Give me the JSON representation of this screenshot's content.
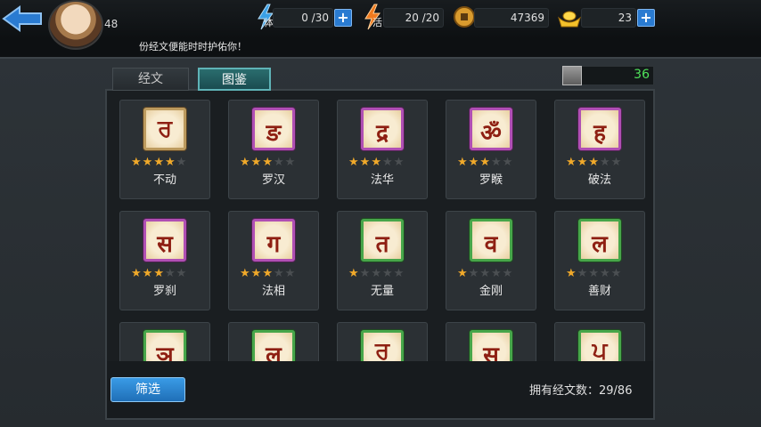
{
  "header": {
    "level": "48",
    "stamina": {
      "label": "体",
      "value": "0 /30"
    },
    "vitality": {
      "label": "活",
      "value": "20 /20"
    },
    "coins": {
      "value": "47369"
    },
    "gold": {
      "value": "23"
    },
    "plus": "+",
    "notice": "份经文便能时时护佑你！"
  },
  "tabs": [
    {
      "label": "经文",
      "active": false
    },
    {
      "label": "图鉴",
      "active": true
    }
  ],
  "collection_count": "36",
  "cards": [
    {
      "name": "不动",
      "stars": 4,
      "glyph": "ਰ",
      "frame": "gold"
    },
    {
      "name": "罗汉",
      "stars": 3,
      "glyph": "ङ",
      "frame": "purple"
    },
    {
      "name": "法华",
      "stars": 3,
      "glyph": "द्र",
      "frame": "purple"
    },
    {
      "name": "罗睺",
      "stars": 3,
      "glyph": "ॐ",
      "frame": "purple"
    },
    {
      "name": "破法",
      "stars": 3,
      "glyph": "ह",
      "frame": "purple"
    },
    {
      "name": "罗刹",
      "stars": 3,
      "glyph": "स",
      "frame": "purple"
    },
    {
      "name": "法相",
      "stars": 3,
      "glyph": "ग",
      "frame": "purple"
    },
    {
      "name": "无量",
      "stars": 1,
      "glyph": "त",
      "frame": "green"
    },
    {
      "name": "金刚",
      "stars": 1,
      "glyph": "व",
      "frame": "green"
    },
    {
      "name": "善财",
      "stars": 1,
      "glyph": "ल",
      "frame": "green"
    },
    {
      "name": "",
      "stars": 0,
      "glyph": "ञ",
      "frame": "green"
    },
    {
      "name": "",
      "stars": 0,
      "glyph": "ल",
      "frame": "green"
    },
    {
      "name": "",
      "stars": 0,
      "glyph": "ਰ",
      "frame": "green"
    },
    {
      "name": "",
      "stars": 0,
      "glyph": "स",
      "frame": "green"
    },
    {
      "name": "",
      "stars": 0,
      "glyph": "ਪ",
      "frame": "green"
    }
  ],
  "footer": {
    "filter_label": "筛选",
    "owned_text": "拥有经文数：29/86"
  },
  "colors": {
    "accent_blue": "#2a7bd1",
    "tab_active": "#2a6d6e",
    "count_green": "#4fe25a",
    "star": "#f0a92a"
  }
}
